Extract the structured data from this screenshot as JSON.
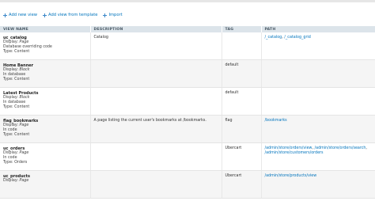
{
  "actions": [
    {
      "label": "Add new view"
    },
    {
      "label": "Add view from template"
    },
    {
      "label": "Import"
    }
  ],
  "table": {
    "headers": {
      "name": "VIEW NAME",
      "description": "DESCRIPTION",
      "tag": "TAG",
      "path": "PATH"
    },
    "rows": [
      {
        "name": "uc_catalog",
        "display_label": "Display:",
        "display": "Page",
        "storage": "Database overriding code",
        "type": "Type: Content",
        "description": "Catalog",
        "tag": "",
        "paths": [
          "/_catalog",
          "/_catalog_grid"
        ],
        "path_sep": ", "
      },
      {
        "name": "Home Banner",
        "display_label": "Display:",
        "display": "Block",
        "storage": "In database",
        "type": "Type: Content",
        "description": "",
        "tag": "default",
        "paths": [],
        "path_sep": ""
      },
      {
        "name": "Latest Products",
        "display_label": "Display:",
        "display": "Block",
        "storage": "In database",
        "type": "Type: Content",
        "description": "",
        "tag": "default",
        "paths": [],
        "path_sep": ""
      },
      {
        "name": "flag_bookmarks",
        "display_label": "Display:",
        "display": "Page",
        "storage": "In code",
        "type": "Type: Content",
        "description": "A page listing the current user's bookmarks at /bookmarks.",
        "tag": "flag",
        "paths": [
          "/bookmarks"
        ],
        "path_sep": ""
      },
      {
        "name": "uc_orders",
        "display_label": "Display:",
        "display": "Page",
        "storage": "In code",
        "type": "Type: Orders",
        "description": "",
        "tag": "Ubercart",
        "paths": [
          "/admin/store/orders/view",
          "/admin/store/orders/search",
          "/admin/store/customers/orders"
        ],
        "path_sep": ", "
      },
      {
        "name": "uc_products",
        "display_label": "Display:",
        "display": "Page",
        "storage": "",
        "type": "",
        "description": "",
        "tag": "Ubercart",
        "paths": [
          "/admin/store/products/view"
        ],
        "path_sep": ""
      }
    ]
  }
}
